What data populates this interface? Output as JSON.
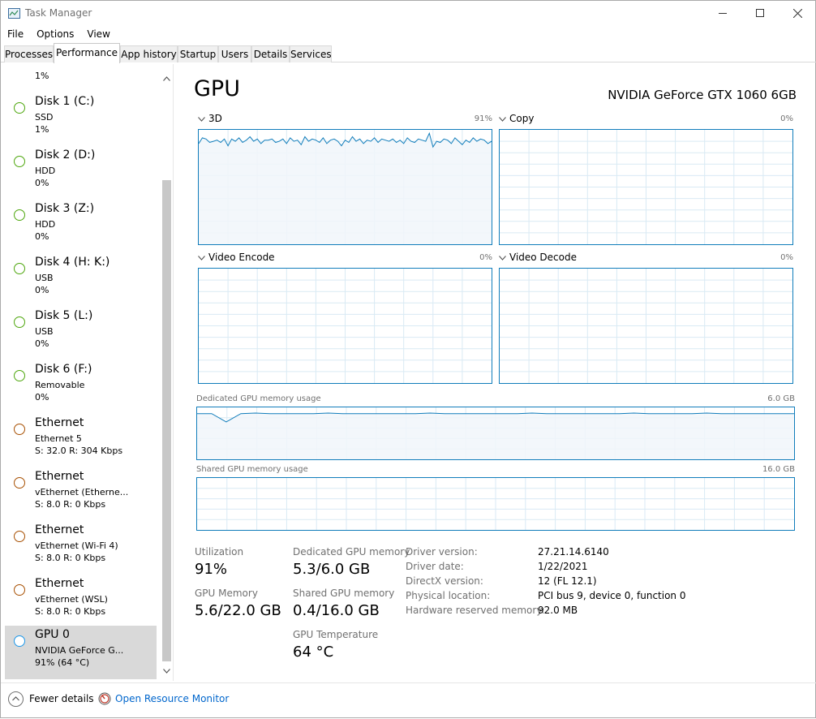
{
  "window": {
    "title": "Task Manager",
    "controls": {
      "minimize_icon": "minimize-icon",
      "maximize_icon": "maximize-icon",
      "close_icon": "close-icon"
    }
  },
  "menu": [
    "File",
    "Options",
    "View"
  ],
  "tabs": [
    {
      "label": "Processes",
      "active": false
    },
    {
      "label": "Performance",
      "active": true
    },
    {
      "label": "App history",
      "active": false
    },
    {
      "label": "Startup",
      "active": false
    },
    {
      "label": "Users",
      "active": false
    },
    {
      "label": "Details",
      "active": false
    },
    {
      "label": "Services",
      "active": false
    }
  ],
  "sidebar": {
    "top_partial_value": "1%",
    "items": [
      {
        "title": "Disk 1 (C:)",
        "sub": "SSD",
        "value": "1%",
        "kind": "disk"
      },
      {
        "title": "Disk 2 (D:)",
        "sub": "HDD",
        "value": "0%",
        "kind": "disk"
      },
      {
        "title": "Disk 3 (Z:)",
        "sub": "HDD",
        "value": "0%",
        "kind": "disk"
      },
      {
        "title": "Disk 4 (H: K:)",
        "sub": "USB",
        "value": "0%",
        "kind": "disk"
      },
      {
        "title": "Disk 5 (L:)",
        "sub": "USB",
        "value": "0%",
        "kind": "disk"
      },
      {
        "title": "Disk 6 (F:)",
        "sub": "Removable",
        "value": "0%",
        "kind": "disk"
      },
      {
        "title": "Ethernet",
        "sub": "Ethernet 5",
        "value": "S: 32.0  R: 304 Kbps",
        "kind": "net"
      },
      {
        "title": "Ethernet",
        "sub": "vEthernet (Etherne...",
        "value": "S: 8.0  R: 0 Kbps",
        "kind": "net"
      },
      {
        "title": "Ethernet",
        "sub": "vEthernet (Wi-Fi 4)",
        "value": "S: 8.0  R: 0 Kbps",
        "kind": "net"
      },
      {
        "title": "Ethernet",
        "sub": "vEthernet (WSL)",
        "value": "S: 8.0  R: 0 Kbps",
        "kind": "net"
      },
      {
        "title": "GPU 0",
        "sub": "NVIDIA GeForce G...",
        "value": "91%  (64 °C)",
        "kind": "gpu",
        "selected": true
      }
    ]
  },
  "colors": {
    "disk": "#4da60c",
    "net": "#a74f01",
    "gpu": "#1c97ea",
    "graph_line": "#117dbb",
    "grid": "#d9eaf4",
    "fill": "#f1f6fa"
  },
  "main": {
    "title": "GPU",
    "device": "NVIDIA GeForce GTX 1060 6GB",
    "engines": [
      {
        "label": "3D",
        "pct": "91%",
        "values": [
          88,
          93,
          92,
          89,
          90,
          91,
          89,
          92,
          86,
          92,
          90,
          93,
          89,
          91,
          94,
          90,
          92,
          88,
          91,
          91,
          92,
          89,
          90,
          92,
          88,
          93,
          90,
          91,
          87,
          94,
          90,
          92,
          91,
          89,
          93,
          88,
          91,
          92,
          90,
          86,
          91,
          89,
          94,
          90,
          92,
          88,
          91,
          90,
          93,
          89,
          92,
          91,
          90,
          92,
          89,
          91,
          88,
          93,
          90,
          89,
          92,
          91,
          90,
          97,
          85,
          90,
          89,
          92,
          91,
          88,
          93,
          90,
          87,
          91,
          89,
          93,
          90,
          92,
          91,
          88,
          90
        ]
      },
      {
        "label": "Copy",
        "pct": "0%",
        "values": []
      },
      {
        "label": "Video Encode",
        "pct": "0%",
        "values": []
      },
      {
        "label": "Video Decode",
        "pct": "0%",
        "values": []
      }
    ],
    "dedicated": {
      "label": "Dedicated GPU memory usage",
      "max": "6.0 GB",
      "values": [
        88,
        88,
        72,
        88,
        89,
        88,
        88,
        88,
        88,
        89,
        88,
        88,
        88,
        88,
        88,
        88,
        89,
        88,
        88,
        88,
        88,
        88,
        88,
        89,
        88,
        88,
        88,
        88,
        88,
        88,
        89,
        88,
        88,
        88,
        88,
        89,
        88,
        88,
        88,
        88,
        88,
        88
      ]
    },
    "shared": {
      "label": "Shared GPU memory usage",
      "max": "16.0 GB",
      "values": []
    },
    "stats": {
      "utilization_label": "Utilization",
      "utilization": "91%",
      "dedicated_label": "Dedicated GPU memory",
      "dedicated": "5.3/6.0 GB",
      "gpu_memory_label": "GPU Memory",
      "gpu_memory": "5.6/22.0 GB",
      "shared_label": "Shared GPU memory",
      "shared": "0.4/16.0 GB",
      "temp_label": "GPU Temperature",
      "temp": "64 °C"
    },
    "info": [
      {
        "label": "Driver version:",
        "value": "27.21.14.6140"
      },
      {
        "label": "Driver date:",
        "value": "1/22/2021"
      },
      {
        "label": "DirectX version:",
        "value": "12 (FL 12.1)"
      },
      {
        "label": "Physical location:",
        "value": "PCI bus 9, device 0, function 0"
      },
      {
        "label": "Hardware reserved memory:",
        "value": "92.0 MB"
      }
    ]
  },
  "footer": {
    "fewer": "Fewer details",
    "monitor": "Open Resource Monitor"
  }
}
